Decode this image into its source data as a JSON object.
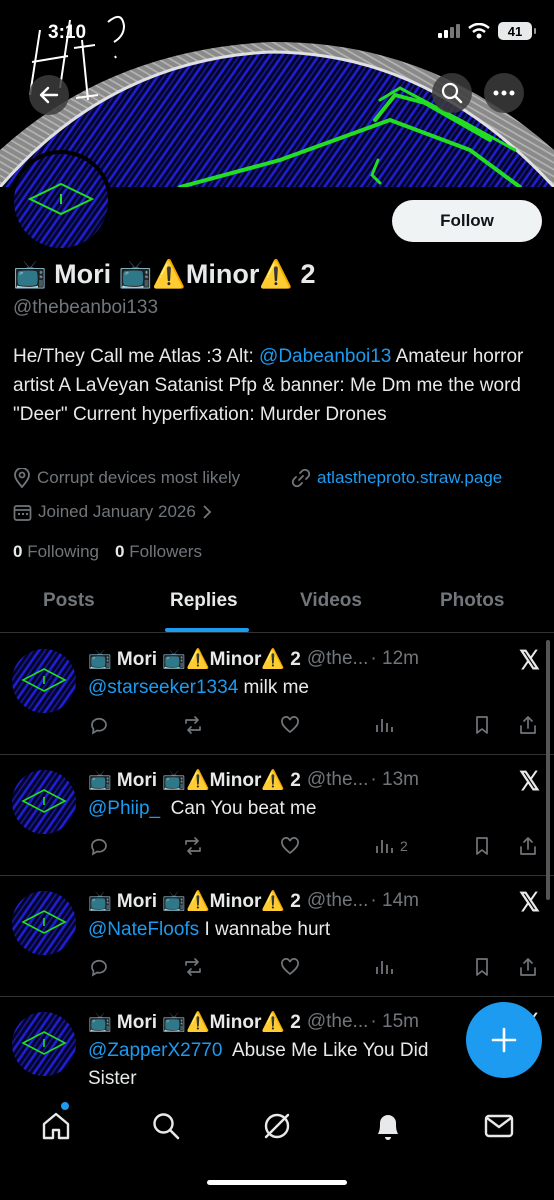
{
  "status": {
    "time": "3:10",
    "battery": "41"
  },
  "banner": {
    "scribble": "HI?"
  },
  "profile": {
    "display_name": "📺 Mori 📺⚠️Minor⚠️ 2",
    "handle": "@thebeanboi133",
    "follow_label": "Follow",
    "bio_part1": "He/They Call me Atlas :3 Alt: ",
    "bio_mention": "@Dabeanboi13",
    "bio_part2": " Amateur horror artist A LaVeyan Satanist Pfp & banner: Me Dm me the word \"Deer\" Current hyperfixation: Murder Drones",
    "location": "Corrupt devices most likely",
    "website": "atlastheproto.straw.page",
    "joined": "Joined January 2026",
    "following_count": "0",
    "following_label": "Following",
    "followers_count": "0",
    "followers_label": "Followers"
  },
  "tabs": [
    "Posts",
    "Replies",
    "Videos",
    "Photos"
  ],
  "posts": [
    {
      "name": "📺 Mori 📺⚠️Minor⚠️ 2",
      "handle": "@the...",
      "time": "· 12m",
      "mention": "@starseeker1334",
      "text": " milk me",
      "views": ""
    },
    {
      "name": "📺 Mori 📺⚠️Minor⚠️ 2",
      "handle": "@the...",
      "time": "· 13m",
      "mention": "@Phiip_",
      "text": "  Can You beat me",
      "views": "2"
    },
    {
      "name": "📺 Mori 📺⚠️Minor⚠️ 2",
      "handle": "@the...",
      "time": "· 14m",
      "mention": "@NateFloofs",
      "text": " I wannabe hurt",
      "views": ""
    },
    {
      "name": "📺 Mori 📺⚠️Minor⚠️ 2",
      "handle": "@the...",
      "time": "· 15m",
      "mention": "@ZapperX2770",
      "text": "  Abuse Me Like You Did",
      "text2": "Sister",
      "views": ""
    }
  ],
  "icons": {
    "back": "back-arrow-icon",
    "search": "search-icon",
    "more": "more-icon",
    "x": "x-logo-icon",
    "reply": "reply-icon",
    "repost": "repost-icon",
    "like": "like-icon",
    "views": "views-icon",
    "bookmark": "bookmark-icon",
    "share": "share-icon"
  },
  "colors": {
    "accent": "#1d9bf0",
    "background": "#000000",
    "text": "#e7e9ea",
    "muted": "#71767b"
  }
}
